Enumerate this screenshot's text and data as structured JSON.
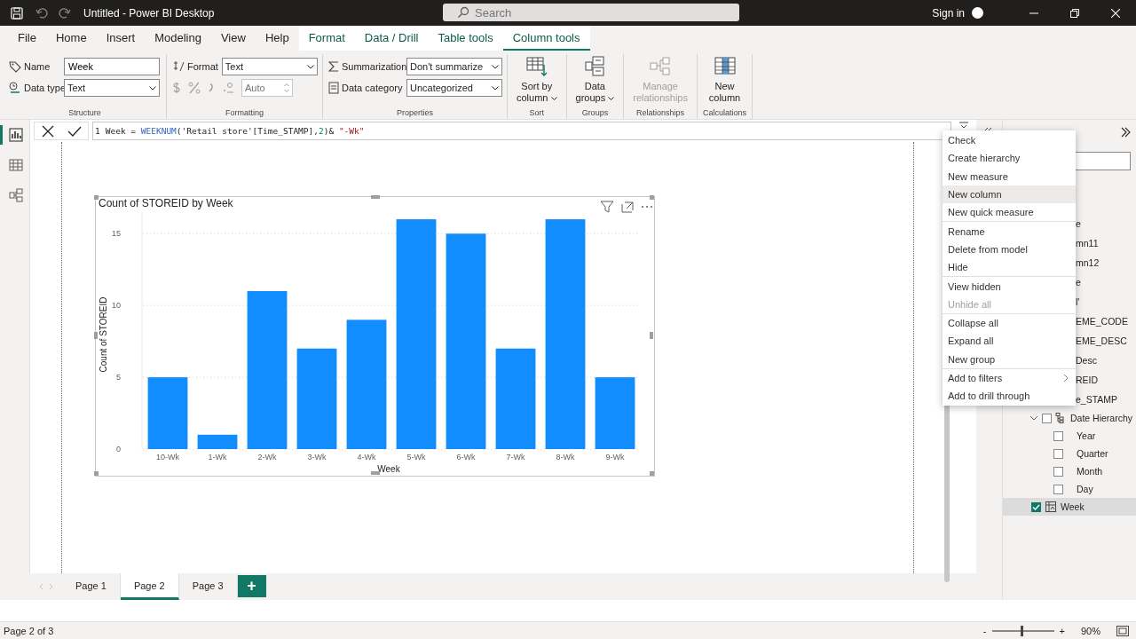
{
  "window": {
    "title": "Untitled - Power BI Desktop",
    "search_placeholder": "Search",
    "sign_in": "Sign in"
  },
  "ribbon_tabs": [
    {
      "label": "File",
      "selected": false,
      "contextual": false
    },
    {
      "label": "Home",
      "selected": false,
      "contextual": false
    },
    {
      "label": "Insert",
      "selected": false,
      "contextual": false
    },
    {
      "label": "Modeling",
      "selected": false,
      "contextual": false
    },
    {
      "label": "View",
      "selected": false,
      "contextual": false
    },
    {
      "label": "Help",
      "selected": false,
      "contextual": false
    },
    {
      "label": "Format",
      "selected": false,
      "contextual": true
    },
    {
      "label": "Data / Drill",
      "selected": false,
      "contextual": true
    },
    {
      "label": "Table tools",
      "selected": false,
      "contextual": true
    },
    {
      "label": "Column tools",
      "selected": true,
      "contextual": true
    }
  ],
  "ribbon": {
    "structure": {
      "title": "Structure",
      "name_label": "Name",
      "name_value": "Week",
      "type_label": "Data type",
      "type_value": "Text"
    },
    "formatting": {
      "title": "Formatting",
      "format_label": "Format",
      "format_value": "Text",
      "decimals_placeholder": "Auto"
    },
    "properties": {
      "title": "Properties",
      "summarization_label": "Summarization",
      "summarization_value": "Don't summarize",
      "category_label": "Data category",
      "category_value": "Uncategorized"
    },
    "big_groups": [
      {
        "title": "Sort",
        "kind": "sort",
        "lines": [
          "Sort by",
          "column"
        ],
        "dropdown": true,
        "disabled": false
      },
      {
        "title": "Groups",
        "kind": "groups",
        "lines": [
          "Data",
          "groups"
        ],
        "dropdown": true,
        "disabled": false
      },
      {
        "title": "Relationships",
        "kind": "relationships",
        "lines": [
          "Manage",
          "relationships"
        ],
        "dropdown": false,
        "disabled": true
      },
      {
        "title": "Calculations",
        "kind": "calculations",
        "lines": [
          "New",
          "column"
        ],
        "dropdown": false,
        "disabled": false
      }
    ]
  },
  "left_rail": [
    {
      "kind": "report",
      "selected": true
    },
    {
      "kind": "table",
      "selected": false
    },
    {
      "kind": "model",
      "selected": false
    }
  ],
  "formula_bar": {
    "line_number": "1",
    "tokens": [
      {
        "kind": "plain",
        "text": "Week = "
      },
      {
        "kind": "function",
        "text": "WEEKNUM"
      },
      {
        "kind": "plain",
        "text": "('Retail store'[Time_STAMP],"
      },
      {
        "kind": "number",
        "text": "2"
      },
      {
        "kind": "plain",
        "text": ")& "
      },
      {
        "kind": "string",
        "text": "\"-Wk\""
      }
    ]
  },
  "visual": {
    "chart_data": {
      "type": "bar",
      "title": "Count of STOREID by Week",
      "xlabel": "Week",
      "ylabel": "Count of STOREID",
      "categories": [
        "10-Wk",
        "1-Wk",
        "2-Wk",
        "3-Wk",
        "4-Wk",
        "5-Wk",
        "6-Wk",
        "7-Wk",
        "8-Wk",
        "9-Wk"
      ],
      "values": [
        5,
        1,
        11,
        7,
        9,
        16,
        15,
        7,
        16,
        5
      ],
      "ylim": [
        0,
        16.5
      ],
      "yticks": [
        0,
        5,
        10,
        15
      ],
      "grid": true
    }
  },
  "context_menu": [
    {
      "label": "Check",
      "selected": false,
      "disabled": false,
      "submenu": false,
      "separator_after": false
    },
    {
      "label": "Create hierarchy",
      "selected": false,
      "disabled": false,
      "submenu": false,
      "separator_after": false
    },
    {
      "label": "New measure",
      "selected": false,
      "disabled": false,
      "submenu": false,
      "separator_after": false
    },
    {
      "label": "New column",
      "selected": true,
      "disabled": false,
      "submenu": false,
      "separator_after": false
    },
    {
      "label": "New quick measure",
      "selected": false,
      "disabled": false,
      "submenu": false,
      "separator_after": true
    },
    {
      "label": "Rename",
      "selected": false,
      "disabled": false,
      "submenu": false,
      "separator_after": false
    },
    {
      "label": "Delete from model",
      "selected": false,
      "disabled": false,
      "submenu": false,
      "separator_after": false
    },
    {
      "label": "Hide",
      "selected": false,
      "disabled": false,
      "submenu": false,
      "separator_after": true
    },
    {
      "label": "View hidden",
      "selected": false,
      "disabled": false,
      "submenu": false,
      "separator_after": false
    },
    {
      "label": "Unhide all",
      "selected": false,
      "disabled": true,
      "submenu": false,
      "separator_after": true
    },
    {
      "label": "Collapse all",
      "selected": false,
      "disabled": false,
      "submenu": false,
      "separator_after": false
    },
    {
      "label": "Expand all",
      "selected": false,
      "disabled": false,
      "submenu": false,
      "separator_after": false
    },
    {
      "label": "New group",
      "selected": false,
      "disabled": false,
      "submenu": false,
      "separator_after": true
    },
    {
      "label": "Add to filters",
      "selected": false,
      "disabled": false,
      "submenu": true,
      "separator_after": false
    },
    {
      "label": "Add to drill through",
      "selected": false,
      "disabled": false,
      "submenu": false,
      "separator_after": false
    }
  ],
  "fields": [
    {
      "kind": "cut",
      "text": "e"
    },
    {
      "kind": "cut",
      "text": "mn11"
    },
    {
      "kind": "cut",
      "text": "mn12"
    },
    {
      "kind": "cut",
      "text": "e"
    },
    {
      "kind": "cut",
      "text": "l'"
    },
    {
      "kind": "cut",
      "text": "EME_CODE"
    },
    {
      "kind": "cut",
      "text": "EME_DESC"
    },
    {
      "kind": "cut",
      "text": "Desc"
    },
    {
      "kind": "cut",
      "text": "REID"
    },
    {
      "kind": "cut",
      "text": "e_STAMP"
    },
    {
      "kind": "hierarchy",
      "text": "Date Hierarchy",
      "expanded": true,
      "checked": false,
      "children": [
        {
          "text": "Year",
          "checked": false
        },
        {
          "text": "Quarter",
          "checked": false
        },
        {
          "text": "Month",
          "checked": false
        },
        {
          "text": "Day",
          "checked": false
        }
      ]
    },
    {
      "kind": "column",
      "text": "Week",
      "checked": true,
      "selected": true
    }
  ],
  "page_tabs": [
    {
      "label": "Page 1",
      "selected": false
    },
    {
      "label": "Page 2",
      "selected": true
    },
    {
      "label": "Page 3",
      "selected": false
    }
  ],
  "add_page": "+",
  "status_bar": {
    "page_info": "Page 2 of 3",
    "zoom_minus": "-",
    "zoom_plus": "+",
    "zoom": "90%",
    "zoom_slider": {
      "level": 0.48
    }
  }
}
